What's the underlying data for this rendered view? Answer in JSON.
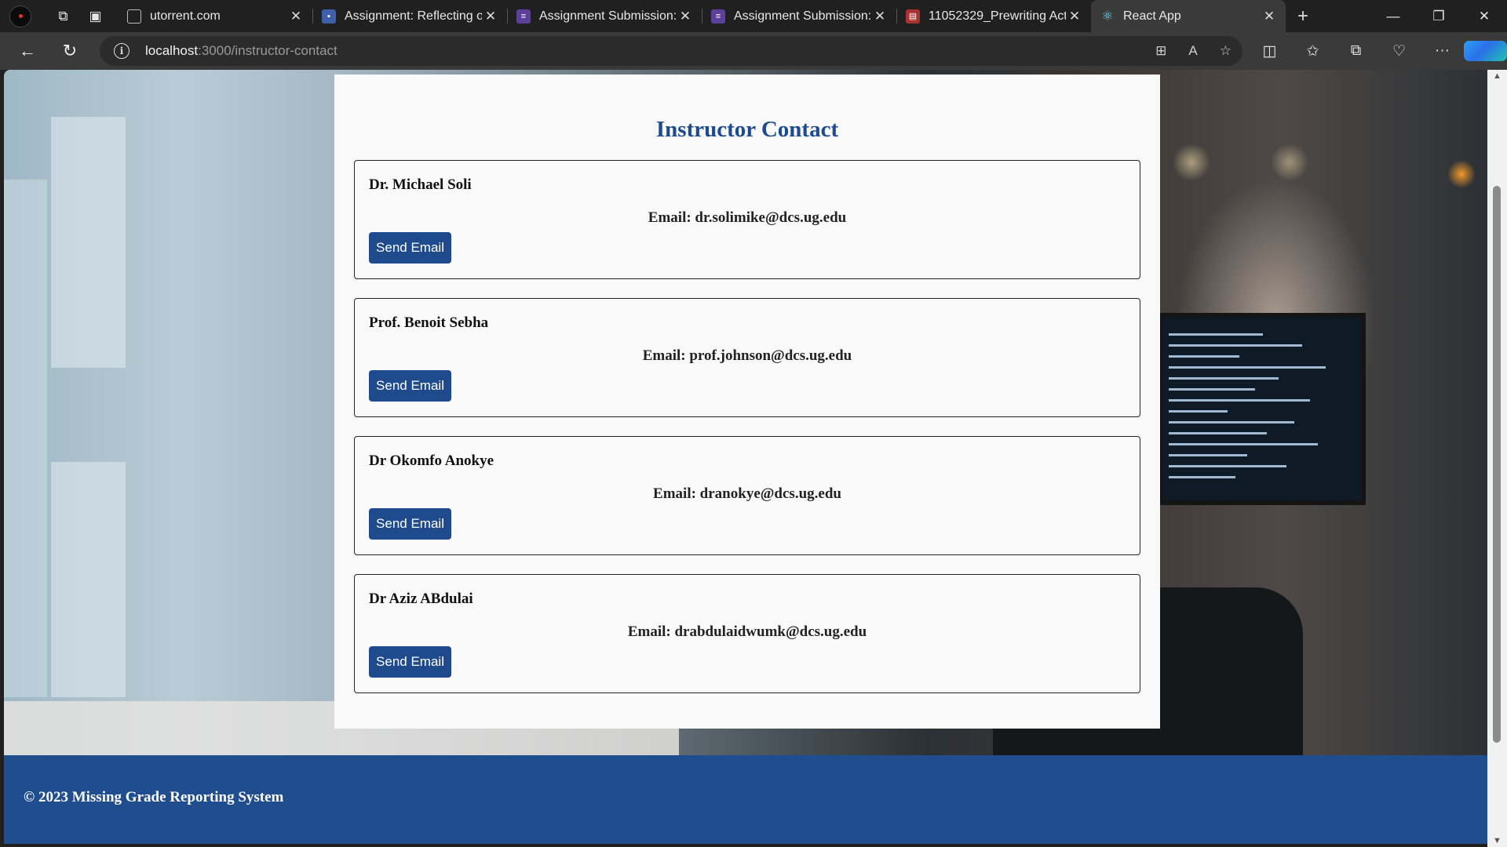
{
  "browser": {
    "tabs": [
      {
        "title": "utorrent.com",
        "favicon": "page-icon",
        "active": false
      },
      {
        "title": "Assignment: Reflecting or",
        "favicon": "assignment-icon",
        "active": false
      },
      {
        "title": "Assignment Submission: I",
        "favicon": "list-icon",
        "active": false
      },
      {
        "title": "Assignment Submission: I",
        "favicon": "list-icon",
        "active": false
      },
      {
        "title": "11052329_Prewriting Acti",
        "favicon": "pdf-icon",
        "active": false
      },
      {
        "title": "React App",
        "favicon": "react-icon",
        "active": true
      }
    ],
    "url_host": "localhost",
    "url_path": ":3000/instructor-contact",
    "accent": "#3a3a3a"
  },
  "page": {
    "title": "Instructor Contact",
    "instructors": [
      {
        "name": "Dr. Michael Soli",
        "email": "Email: dr.solimike@dcs.ug.edu",
        "button": "Send Email"
      },
      {
        "name": "Prof. Benoit Sebha",
        "email": "Email: prof.johnson@dcs.ug.edu",
        "button": "Send Email"
      },
      {
        "name": "Dr Okomfo Anokye",
        "email": "Email: dranokye@dcs.ug.edu",
        "button": "Send Email"
      },
      {
        "name": "Dr Aziz ABdulai",
        "email": "Email: drabdulaidwumk@dcs.ug.edu",
        "button": "Send Email"
      }
    ],
    "title_color": "#1d4b8f",
    "button_color": "#1f4a8c"
  },
  "footer": {
    "text": "© 2023 Missing Grade Reporting System",
    "color": "#1f4d8d"
  }
}
